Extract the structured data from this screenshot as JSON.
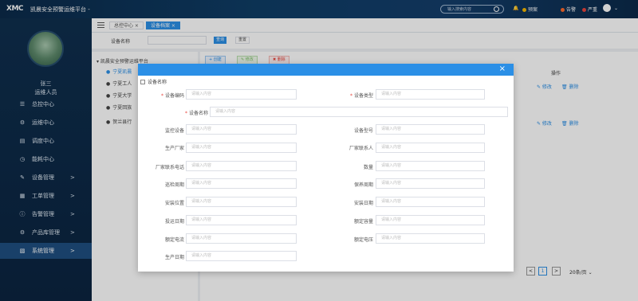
{
  "header": {
    "logo": "XMC",
    "title": "凯晨安全预警运维平台 -",
    "search_placeholder": "输入搜索内容",
    "pills": [
      {
        "label": "预案",
        "color": "#f5b700"
      },
      {
        "label": "告警",
        "color": "#ff6a2a"
      },
      {
        "label": "严重",
        "color": "#e8453c"
      }
    ],
    "chevron": "⌄"
  },
  "sidebar": {
    "user_name": "张三",
    "user_role": "运维人员",
    "items": [
      {
        "label": "总控中心",
        "icon": "☰",
        "arrow": ""
      },
      {
        "label": "运维中心",
        "icon": "⚙",
        "arrow": ""
      },
      {
        "label": "调度中心",
        "icon": "▤",
        "arrow": ""
      },
      {
        "label": "能耗中心",
        "icon": "◷",
        "arrow": ""
      },
      {
        "label": "设备管理",
        "icon": "✎",
        "arrow": ">"
      },
      {
        "label": "工单管理",
        "icon": "▦",
        "arrow": ">"
      },
      {
        "label": "告警管理",
        "icon": "ⓘ",
        "arrow": ">"
      },
      {
        "label": "产品库管理",
        "icon": "⚙",
        "arrow": ">"
      },
      {
        "label": "系统管理",
        "icon": "▧",
        "arrow": ">"
      }
    ]
  },
  "tabs": [
    {
      "label": "总控中心 ×"
    },
    {
      "label": "设备档案 ×"
    }
  ],
  "filter": {
    "label": "设备名称",
    "query_label": "查询",
    "reset_label": "重置"
  },
  "tree": {
    "root": "凯晨安全预警运维平台",
    "nodes": [
      "宁夏凯晨",
      "宁夏工人",
      "宁夏大学",
      "宁夏回族",
      "贺兰县行"
    ]
  },
  "toolbar": {
    "add": "+ 创建",
    "edit": "✎ 修改",
    "delete": "✖ 删除"
  },
  "table": {
    "op_header": "操作",
    "rows": [
      {
        "edit": "✎ 修改",
        "delete": "🗑 删除"
      },
      {
        "edit": "✎ 修改",
        "delete": "🗑 删除"
      }
    ]
  },
  "pager": {
    "prev": "<",
    "page": "1",
    "next": ">",
    "size": "20条/页 ⌄"
  },
  "modal": {
    "close": "×",
    "checkbox_label": "设备名称",
    "placeholder": "请输入内容",
    "fields_left": [
      {
        "label": "设备编码",
        "required": true
      },
      {
        "label": "设备名称",
        "required": true
      },
      {
        "label": "监控设备",
        "required": false
      },
      {
        "label": "生产厂家",
        "required": false
      },
      {
        "label": "厂家联系电话",
        "required": false
      },
      {
        "label": "巡检周期",
        "required": false
      },
      {
        "label": "安装位置",
        "required": false
      },
      {
        "label": "投运日期",
        "required": false
      },
      {
        "label": "额定电流",
        "required": false
      },
      {
        "label": "生产日期",
        "required": false
      }
    ],
    "fields_right": [
      {
        "label": "设备类型",
        "required": true
      },
      {
        "label": "设备型号",
        "required": false
      },
      {
        "label": "厂家联系人",
        "required": false
      },
      {
        "label": "数量",
        "required": false
      },
      {
        "label": "保养周期",
        "required": false
      },
      {
        "label": "安装日期",
        "required": false
      },
      {
        "label": "额定容量",
        "required": false
      },
      {
        "label": "额定电压",
        "required": false
      }
    ]
  }
}
